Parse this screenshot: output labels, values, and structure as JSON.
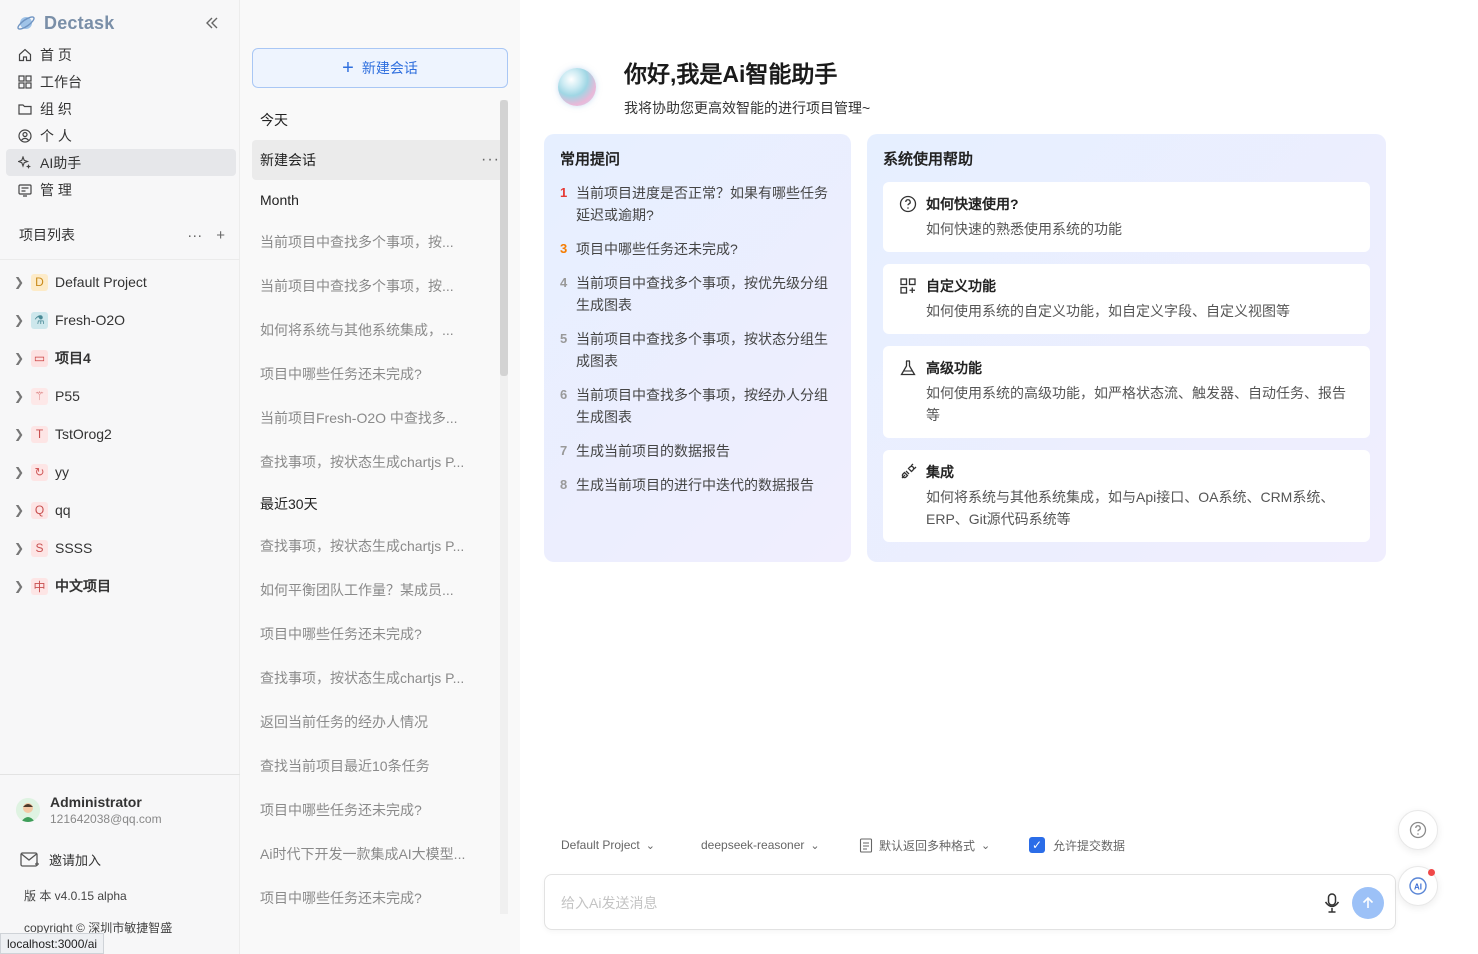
{
  "brand": {
    "name": "Dectask"
  },
  "nav": [
    {
      "label": "首 页",
      "icon": "home-icon"
    },
    {
      "label": "工作台",
      "icon": "dashboard-icon"
    },
    {
      "label": "组 织",
      "icon": "folder-icon"
    },
    {
      "label": "个 人",
      "icon": "user-icon"
    },
    {
      "label": "AI助手",
      "icon": "sparkle-icon",
      "active": true
    },
    {
      "label": "管 理",
      "icon": "admin-icon"
    }
  ],
  "projects_header": {
    "title": "项目列表"
  },
  "projects": [
    {
      "name": "Default Project",
      "badge": "D",
      "badge_bg": "#fdebc8",
      "badge_color": "#c98a1a",
      "bold": false
    },
    {
      "name": "Fresh-O2O",
      "badge": "⚗",
      "badge_bg": "#cde7ec",
      "badge_color": "#4a8a96",
      "bold": false
    },
    {
      "name": "项目4",
      "badge": "▭",
      "badge_bg": "#fde2e2",
      "badge_color": "#c44",
      "bold": true
    },
    {
      "name": "P55",
      "badge": "⚚",
      "badge_bg": "#fde8e8",
      "badge_color": "#d46a6a",
      "bold": false
    },
    {
      "name": "TstOrog2",
      "badge": "T",
      "badge_bg": "#fde5e5",
      "badge_color": "#c85050",
      "bold": false
    },
    {
      "name": "yy",
      "badge": "↻",
      "badge_bg": "#fde5e5",
      "badge_color": "#d05a5a",
      "bold": false
    },
    {
      "name": "qq",
      "badge": "Q",
      "badge_bg": "#fde5e5",
      "badge_color": "#c85050",
      "bold": false
    },
    {
      "name": "SSSS",
      "badge": "S",
      "badge_bg": "#fde5e5",
      "badge_color": "#c85050",
      "bold": false
    },
    {
      "name": "中文项目",
      "badge": "中",
      "badge_bg": "#fde5e5",
      "badge_color": "#c85050",
      "bold": true
    }
  ],
  "user": {
    "name": "Administrator",
    "email": "121642038@qq.com"
  },
  "invite": {
    "label": "邀请加入"
  },
  "version": "版 本 v4.0.15 alpha",
  "copyright": "copyright © 深圳市敏捷智盛",
  "statusbar": "localhost:3000/ai",
  "conversations": {
    "new_chat_label": "新建会话",
    "groups": [
      {
        "label": "今天",
        "items": [
          {
            "title": "新建会话",
            "active": true
          }
        ]
      },
      {
        "label": "Month",
        "items": [
          {
            "title": "当前项目中查找多个事项，按..."
          },
          {
            "title": "当前项目中查找多个事项，按..."
          },
          {
            "title": "如何将系统与其他系统集成，..."
          },
          {
            "title": "项目中哪些任务还未完成?"
          },
          {
            "title": "当前项目Fresh-O2O 中查找多..."
          },
          {
            "title": "查找事项，按状态生成chartjs P..."
          }
        ]
      },
      {
        "label": "最近30天",
        "items": [
          {
            "title": "查找事项，按状态生成chartjs P..."
          },
          {
            "title": "如何平衡团队工作量？某成员..."
          },
          {
            "title": "项目中哪些任务还未完成?"
          },
          {
            "title": "查找事项，按状态生成chartjs P..."
          },
          {
            "title": "返回当前任务的经办人情况"
          },
          {
            "title": "查找当前项目最近10条任务"
          },
          {
            "title": "项目中哪些任务还未完成?"
          },
          {
            "title": "Ai时代下开发一款集成AI大模型..."
          },
          {
            "title": "项目中哪些任务还未完成?"
          }
        ]
      }
    ]
  },
  "hero": {
    "title": "你好,我是Ai智能助手",
    "subtitle": "我将协助您更高效智能的进行项目管理~"
  },
  "prompts": {
    "title": "常用提问",
    "items": [
      {
        "num": "1",
        "text": "当前项目进度是否正常？如果有哪些任务延迟或逾期?"
      },
      {
        "num": "3",
        "text": "项目中哪些任务还未完成?"
      },
      {
        "num": "4",
        "text": "当前项目中查找多个事项，按优先级分组生成图表"
      },
      {
        "num": "5",
        "text": "当前项目中查找多个事项，按状态分组生成图表"
      },
      {
        "num": "6",
        "text": "当前项目中查找多个事项，按经办人分组生成图表"
      },
      {
        "num": "7",
        "text": "生成当前项目的数据报告"
      },
      {
        "num": "8",
        "text": "生成当前项目的进行中迭代的数据报告"
      }
    ]
  },
  "help": {
    "title": "系统使用帮助",
    "items": [
      {
        "icon": "question-circle-icon",
        "title": "如何快速使用?",
        "desc": "如何快速的熟悉使用系统的功能"
      },
      {
        "icon": "custom-grid-icon",
        "title": "自定义功能",
        "desc": "如何使用系统的自定义功能，如自定义字段、自定义视图等"
      },
      {
        "icon": "flask-icon",
        "title": "高级功能",
        "desc": "如何使用系统的高级功能，如严格状态流、触发器、自动任务、报告等"
      },
      {
        "icon": "plug-icon",
        "title": "集成",
        "desc": "如何将系统与其他系统集成，如与Api接口、OA系统、CRM系统、ERP、Git源代码系统等"
      }
    ]
  },
  "options": {
    "project": "Default Project",
    "model": "deepseek-reasoner",
    "format": "默认返回多种格式",
    "allow_submit": "允许提交数据"
  },
  "input": {
    "placeholder": "给入Ai发送消息"
  }
}
